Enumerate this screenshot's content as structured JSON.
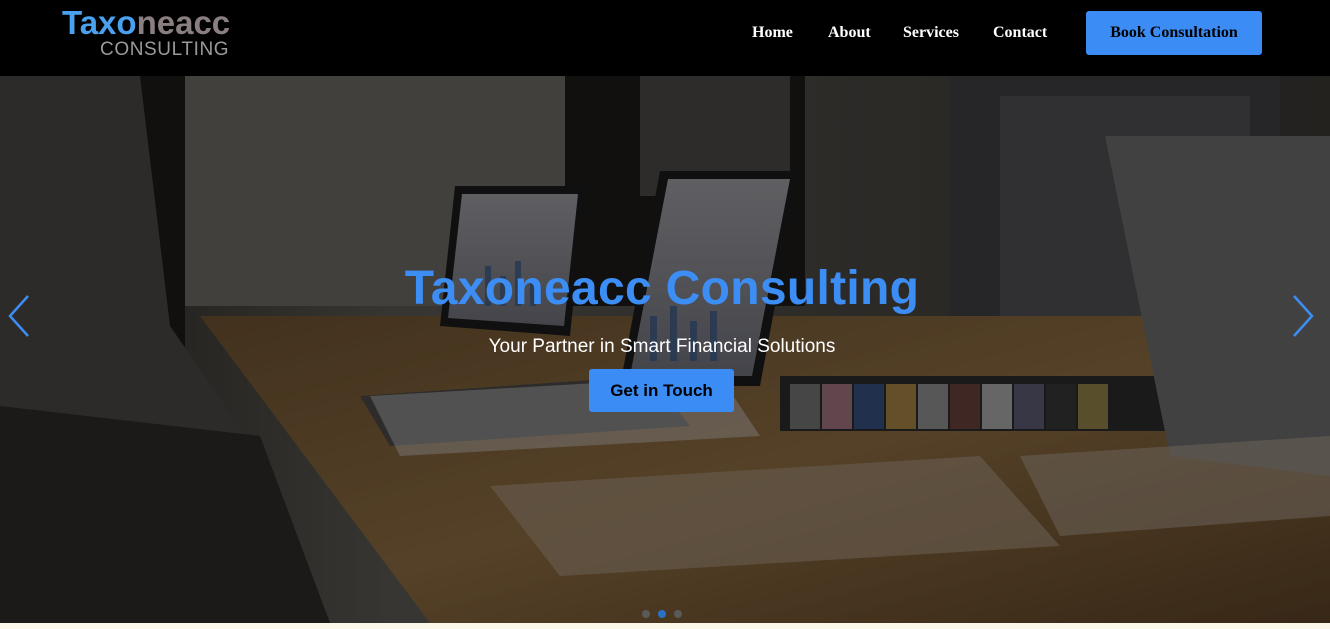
{
  "brand": {
    "name_part1": "Taxo",
    "name_part2": "neacc",
    "tagline": "CONSULTING"
  },
  "nav": {
    "links": [
      {
        "label": "Home"
      },
      {
        "label": "About"
      },
      {
        "label": "Services"
      },
      {
        "label": "Contact"
      }
    ],
    "cta_label": "Book Consultation"
  },
  "hero": {
    "title": "Taxoneacc Consulting",
    "subtitle": "Your Partner in Smart Financial Solutions",
    "button_label": "Get in Touch",
    "prev_icon": "chevron-left-icon",
    "next_icon": "chevron-right-icon",
    "slides_total": 3,
    "active_slide": 2
  },
  "colors": {
    "accent": "#3b8cf5",
    "navbar_bg": "#000000",
    "title_blue": "#3c8ef4",
    "logo_blue": "#4aa1f0",
    "logo_gray": "#8a7f80"
  }
}
